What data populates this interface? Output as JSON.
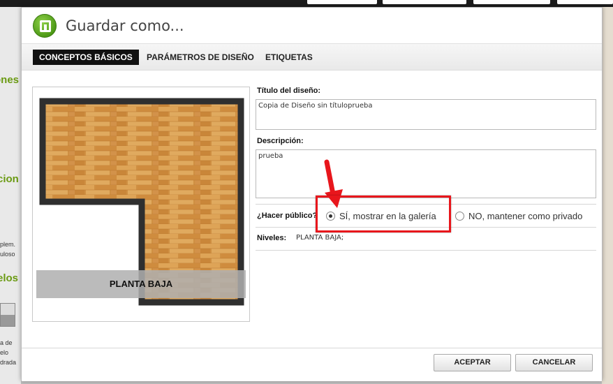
{
  "dialog": {
    "title": "Guardar como...",
    "tabs": [
      {
        "label": "CONCEPTOS BÁSICOS",
        "active": true
      },
      {
        "label": "PARÁMETROS DE DISEÑO",
        "active": false
      },
      {
        "label": "ETIQUETAS",
        "active": false
      }
    ],
    "preview": {
      "level_label": "PLANTA BAJA"
    },
    "form": {
      "title_label": "Título del diseño:",
      "title_value": "Copia de Diseño sin títuloprueba",
      "description_label": "Descripción:",
      "description_value": "prueba",
      "public_label": "¿Hacer público?",
      "public_yes_label": "SÍ, mostrar en la galería",
      "public_no_label": "NO, mantener como privado",
      "public_selected": "yes",
      "levels_label": "Niveles:",
      "levels_value": "PLANTA BAJA;"
    },
    "buttons": {
      "accept": "ACEPTAR",
      "cancel": "CANCELAR"
    }
  },
  "background": {
    "left_texts": [
      "ones",
      "cion",
      "plem.",
      "uloso",
      "elos",
      "a de",
      "elo",
      "drada"
    ]
  },
  "colors": {
    "accent_green": "#5aa41c",
    "highlight_red": "#e8161c",
    "tab_active_bg": "#111111"
  }
}
